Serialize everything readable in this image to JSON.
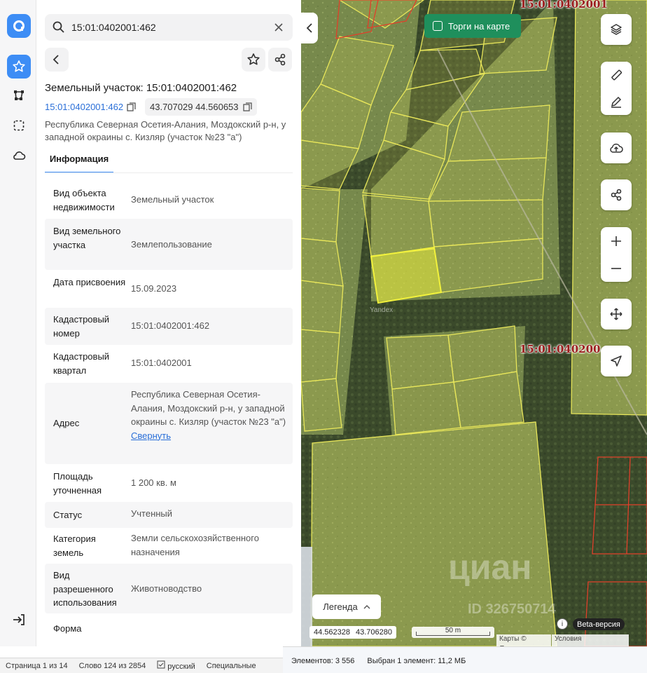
{
  "search": {
    "query": "15:01:0402001:462"
  },
  "panel": {
    "title": "Земельный участок: 15:01:0402001:462",
    "cadastral_link": "15:01:0402001:462",
    "coords_chip": "43.707029 44.560653",
    "address_sub": "Республика Северная Осетия-Алания, Моздокский р-н, у западной окраины с. Кизляр (участок №23 \"а\")",
    "tab_info": "Информация",
    "rows": [
      {
        "key": "Вид объекта недвижимости",
        "value": "Земельный участок"
      },
      {
        "key": "Вид земельного участка",
        "value": "Землепользование"
      },
      {
        "key": "Дата присвоения",
        "value": "15.09.2023"
      },
      {
        "key": "Кадастровый номер",
        "value": "15:01:0402001:462"
      },
      {
        "key": "Кадастровый квартал",
        "value": "15:01:0402001"
      },
      {
        "key": "Адрес",
        "value": "Республика Северная Осетия-Алания, Моздокский р-н, у западной окраины с. Кизляр (участок №23 \"а\")",
        "link": "Свернуть"
      },
      {
        "key": "Площадь уточненная",
        "value": "1 200 кв. м"
      },
      {
        "key": "Статус",
        "value": "Учтенный"
      },
      {
        "key": "Категория земель",
        "value": "Земли сельскохозяйственного назначения"
      },
      {
        "key": "Вид разрешенного использования",
        "value": "Животноводство"
      },
      {
        "key": "Форма",
        "value": ""
      }
    ]
  },
  "map": {
    "torgi_label": "Торги на карте",
    "quarter_label_top": "15:01:0402001",
    "quarter_label_mid": "15:01:040200",
    "legend_label": "Легенда",
    "coords": {
      "lon": "44.562328",
      "lat": "43.706280"
    },
    "scale_label": "50 m",
    "attribution_1": "Карты © Яндекс",
    "attribution_2": "Условия использования",
    "beta_label": "Beta-версия",
    "watermark_yandex": "Yandex",
    "watermark_cian": "циан",
    "watermark_id": "ID 326750714",
    "colors": {
      "parcel": "#e8e65a",
      "parcel_selected": "#f2f23c",
      "parcel_red": "#e0402a",
      "accent": "#3d8df5",
      "torgi": "#1f8f5c"
    }
  },
  "word_status": {
    "page": "Страница 1 из 14",
    "words": "Слово 124 из 2854",
    "lang": "русский",
    "special": "Специальные"
  },
  "excel_status": {
    "elements": "Элементов: 3 556",
    "selected": "Выбран 1 элемент: 11,2 МБ"
  },
  "icons": [
    "app-logo-icon",
    "star-icon",
    "polygon-icon",
    "select-area-icon",
    "cloud-icon",
    "logout-icon",
    "search-icon",
    "close-icon",
    "back-icon",
    "share-icon",
    "copy-icon",
    "layers-icon",
    "ruler-icon",
    "edit-icon",
    "upload-cloud-icon",
    "zoom-in-icon",
    "zoom-out-icon",
    "move-icon",
    "locate-icon",
    "chevron-left-icon",
    "chevron-up-icon"
  ]
}
